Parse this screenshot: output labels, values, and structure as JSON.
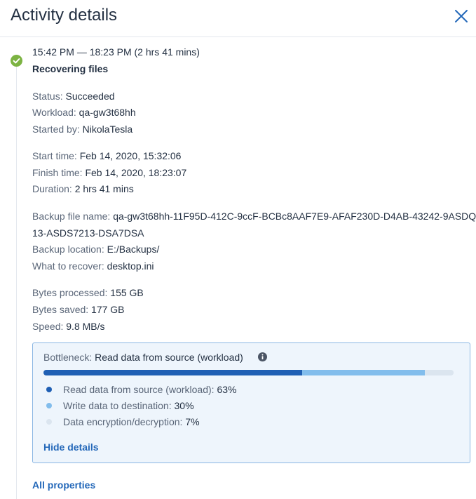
{
  "header": {
    "title": "Activity details",
    "close_icon": "close-icon"
  },
  "activity": {
    "time_range": "15:42 PM — 18:23 PM (2 hrs 41 mins)",
    "name": "Recovering files",
    "status_icon": "check-circle-icon",
    "status_color": "#7cb342"
  },
  "summary": {
    "status": {
      "label": "Status:",
      "value": "Succeeded"
    },
    "workload": {
      "label": "Workload:",
      "value": "qa-gw3t68hh"
    },
    "started_by": {
      "label": "Started by:",
      "value": "NikolaTesla"
    }
  },
  "timing": {
    "start_time": {
      "label": "Start time:",
      "value": "Feb 14, 2020, 15:32:06"
    },
    "finish_time": {
      "label": "Finish time:",
      "value": "Feb 14, 2020, 18:23:07"
    },
    "duration": {
      "label": "Duration:",
      "value": "2 hrs 41 mins"
    }
  },
  "backup": {
    "file_name": {
      "label": "Backup file name:",
      "value_line1": "qa-gw3t68hh-11F95D-412C-9ccF-BCBc8AAF7E9-AFAF230D-D4AB-43242-9ASDQ",
      "value_line2": "13-ASDS7213-DSA7DSA"
    },
    "location": {
      "label": "Backup location:",
      "value": "E:/Backups/"
    },
    "what_to_recover": {
      "label": "What to recover:",
      "value": "desktop.ini"
    }
  },
  "stats": {
    "bytes_processed": {
      "label": "Bytes processed:",
      "value": "155 GB"
    },
    "bytes_saved": {
      "label": "Bytes saved:",
      "value": "177 GB"
    },
    "speed": {
      "label": "Speed:",
      "value": "9.8 MB/s"
    }
  },
  "bottleneck": {
    "label": "Bottleneck:",
    "value": "Read data from source (workload)",
    "info_icon": "info-icon",
    "segments": [
      {
        "name": "Read data from source (workload):",
        "percent": "63%",
        "fraction": 0.63,
        "color": "#1f5fb4"
      },
      {
        "name": "Write data to destination:",
        "percent": "30%",
        "fraction": 0.3,
        "color": "#82bdec"
      },
      {
        "name": "Data encryption/decryption:",
        "percent": "7%",
        "fraction": 0.07,
        "color": "#dbe5ef"
      }
    ],
    "hide_details": "Hide details"
  },
  "footer": {
    "all_properties": "All properties"
  }
}
